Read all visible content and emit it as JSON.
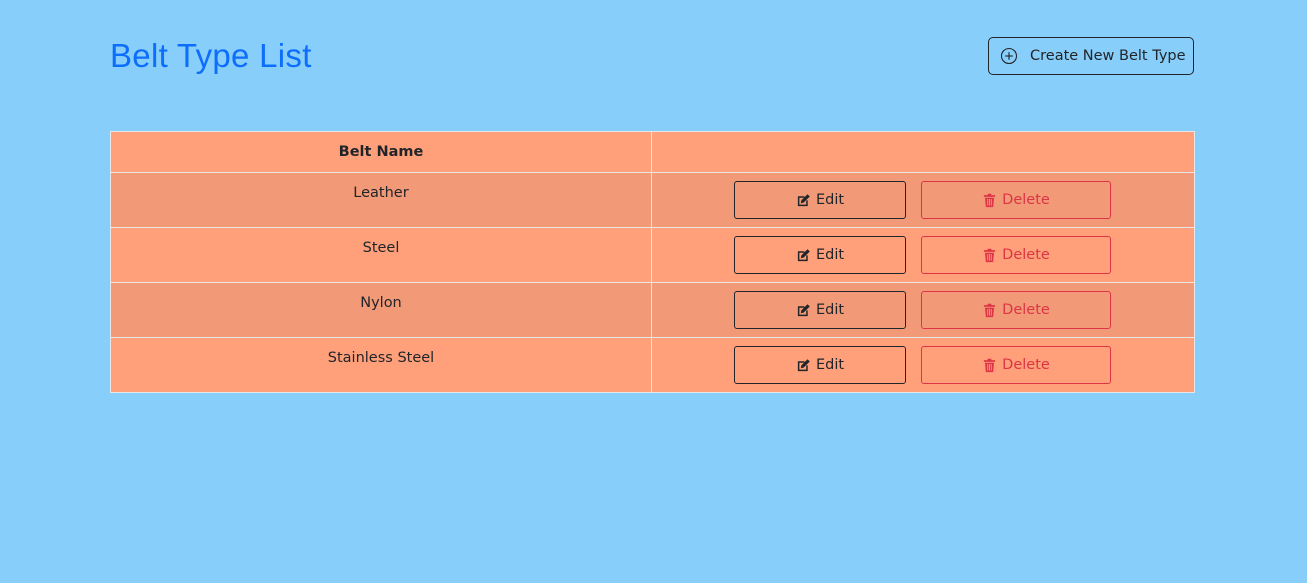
{
  "page": {
    "title": "Belt Type List"
  },
  "toolbar": {
    "create_label": "Create New Belt Type",
    "create_icon": "plus-circle-icon"
  },
  "table": {
    "columns": [
      "Belt Name",
      ""
    ],
    "rows": [
      {
        "name": "Leather",
        "edit_label": "Edit",
        "delete_label": "Delete"
      },
      {
        "name": "Steel",
        "edit_label": "Edit",
        "delete_label": "Delete"
      },
      {
        "name": "Nylon",
        "edit_label": "Edit",
        "delete_label": "Delete"
      },
      {
        "name": "Stainless Steel",
        "edit_label": "Edit",
        "delete_label": "Delete"
      }
    ],
    "edit_icon": "edit-icon",
    "delete_icon": "trash-icon"
  },
  "colors": {
    "background": "#87cefa",
    "title": "#0d6efd",
    "table_row": "#ffa07a",
    "table_row_alt": "#f29a77",
    "danger": "#dc3545",
    "dark": "#212529"
  }
}
